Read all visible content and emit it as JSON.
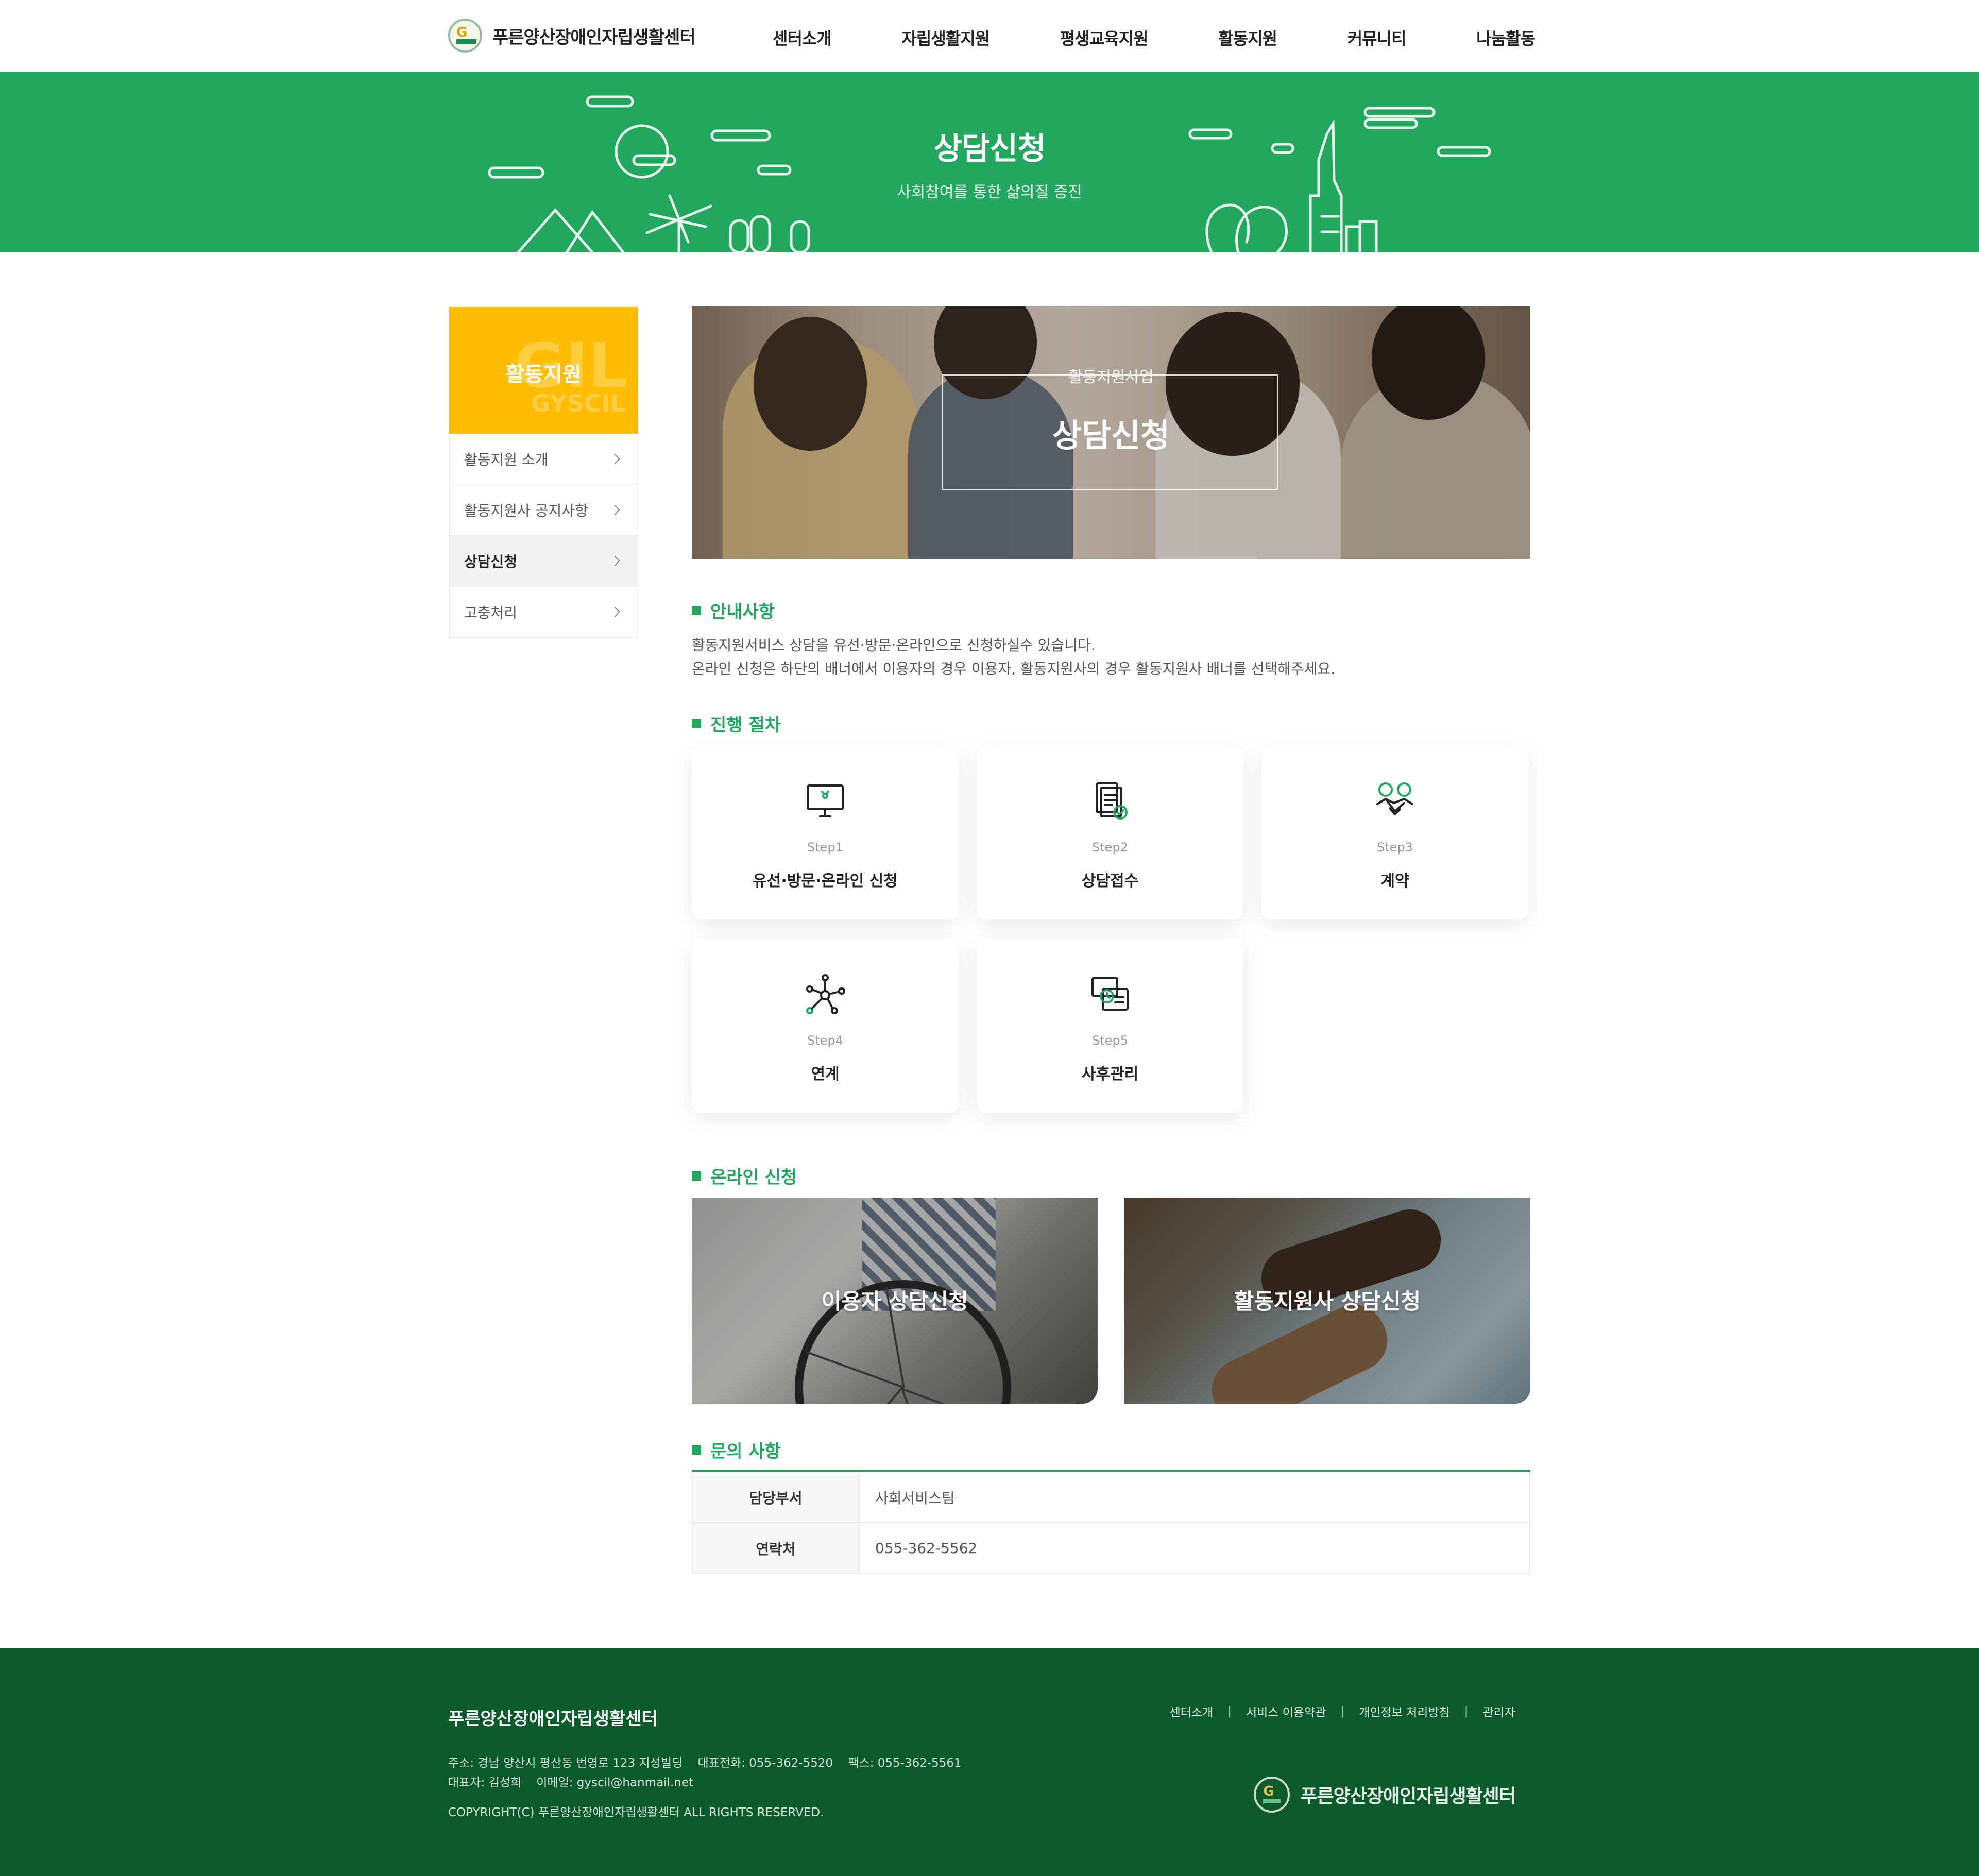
{
  "header": {
    "logo_text": "푸른양산장애인자립생활센터",
    "nav": [
      "센터소개",
      "자립생활지원",
      "평생교육지원",
      "활동지원",
      "커뮤니티",
      "나눔활동"
    ]
  },
  "hero": {
    "title": "상담신청",
    "subtitle": "사회참여를 통한 삶의질 증진"
  },
  "sidebar": {
    "title": "활동지원",
    "watermark": "GIL",
    "watermark_sub": "GYSCIL",
    "items": [
      {
        "label": "활동지원 소개"
      },
      {
        "label": "활동지원사 공지사항"
      },
      {
        "label": "상담신청"
      },
      {
        "label": "고충처리"
      }
    ]
  },
  "banner": {
    "subtitle": "활동지원사업",
    "title": "상담신청"
  },
  "guide": {
    "title": "안내사항",
    "line1": "활동지원서비스 상담을 유선·방문·온라인으로 신청하실수 있습니다.",
    "line2": "온라인 신청은 하단의 배너에서 이용자의 경우 이용자, 활동지원사의 경우 활동지원사 배너를 선택해주세요."
  },
  "process": {
    "title": "진행 절차",
    "steps": [
      {
        "step": "Step1",
        "name": "유선·방문·온라인 신청",
        "icon": "computer-icon"
      },
      {
        "step": "Step2",
        "name": "상담접수",
        "icon": "document-check-icon"
      },
      {
        "step": "Step3",
        "name": "계약",
        "icon": "handshake-icon"
      },
      {
        "step": "Step4",
        "name": "연계",
        "icon": "network-icon"
      },
      {
        "step": "Step5",
        "name": "사후관리",
        "icon": "clock-screen-icon"
      }
    ]
  },
  "online": {
    "title": "온라인 신청",
    "user_label": "이용자 상담신청",
    "worker_label": "활동지원사 상담신청"
  },
  "contact": {
    "title": "문의 사항",
    "rows": [
      {
        "th": "담당부서",
        "td": "사회서비스팀"
      },
      {
        "th": "연락처",
        "td": "055-362-5562"
      }
    ]
  },
  "footer": {
    "name": "푸른양산장애인자립생활센터",
    "address": "주소: 경남 양산시 평산동 번영로 123 지성빌딩    대표전화: 055-362-5520    팩스: 055-362-5561",
    "rep": "대표자: 김성희    이메일: gyscil@hanmail.net",
    "copyright": "COPYRIGHT(C) 푸른양산장애인자립생활센터 ALL RIGHTS RESERVED.",
    "links": [
      "센터소개",
      "서비스 이용약관",
      "개인정보 처리방침",
      "관리자"
    ],
    "logo_text": "푸른양산장애인자립생활센터"
  },
  "colors": {
    "brand_green": "#21a75e",
    "footer_green": "#0b5a2b",
    "side_yellow": "#ffbc00"
  }
}
